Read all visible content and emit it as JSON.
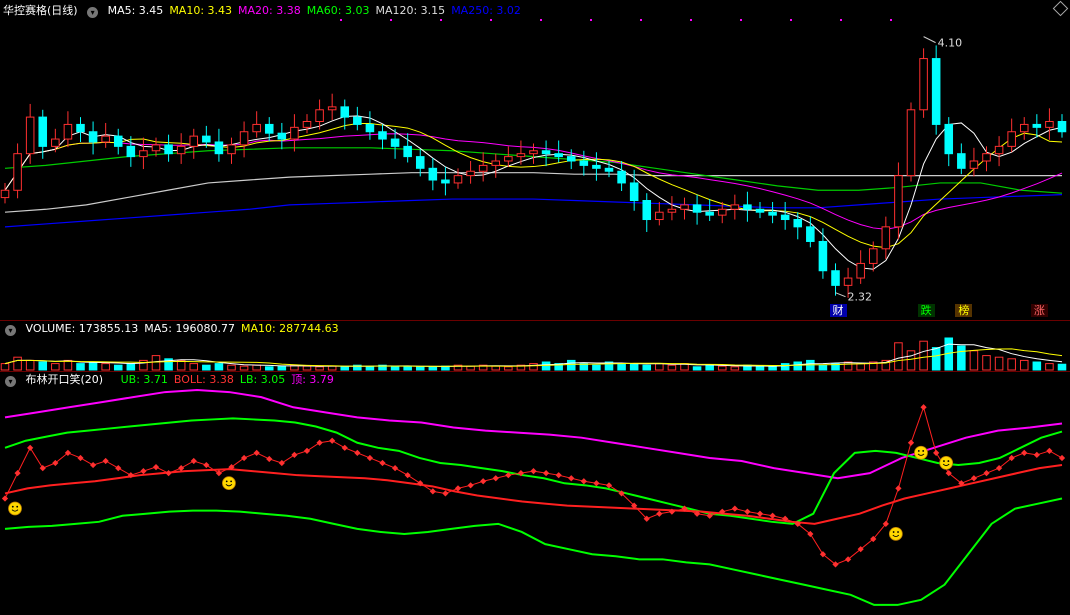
{
  "main": {
    "title": "华控赛格(日线)",
    "indicators": [
      {
        "label": "MA5: 3.45",
        "color": "#ffffff"
      },
      {
        "label": "MA10: 3.43",
        "color": "#ffff00"
      },
      {
        "label": "MA20: 3.38",
        "color": "#ff00ff"
      },
      {
        "label": "MA60: 3.03",
        "color": "#00ff00"
      },
      {
        "label": "MA120: 3.15",
        "color": "#dddddd"
      },
      {
        "label": "MA250: 3.02",
        "color": "#0000ff"
      }
    ],
    "high_label": "4.10",
    "low_label": "2.32",
    "events": [
      {
        "label": "财",
        "color": "#ffffff",
        "bg": "#0000aa"
      },
      {
        "label": "跌",
        "color": "#00ff00",
        "bg": "#003300"
      },
      {
        "label": "榜",
        "color": "#ffff00",
        "bg": "#553300"
      },
      {
        "label": "涨",
        "color": "#ff6666",
        "bg": "#330000"
      }
    ]
  },
  "volume": {
    "indicators": [
      {
        "label": "VOLUME: 173855.13",
        "color": "#ffffff"
      },
      {
        "label": "MA5: 196080.77",
        "color": "#ffffff"
      },
      {
        "label": "MA10: 287744.63",
        "color": "#ffff00"
      }
    ]
  },
  "boll": {
    "title": "布林开口笑(20)",
    "indicators": [
      {
        "label": "UB: 3.71",
        "color": "#00ff00"
      },
      {
        "label": "BOLL: 3.38",
        "color": "#ff3333"
      },
      {
        "label": "LB: 3.05",
        "color": "#00ff00"
      },
      {
        "label": "顶: 3.79",
        "color": "#ff00ff"
      }
    ]
  },
  "chart_data": {
    "type": "line",
    "price_ylim": [
      2.3,
      4.2
    ],
    "close": [
      3.05,
      3.3,
      3.55,
      3.35,
      3.4,
      3.5,
      3.45,
      3.38,
      3.42,
      3.35,
      3.28,
      3.32,
      3.36,
      3.3,
      3.35,
      3.42,
      3.38,
      3.3,
      3.36,
      3.45,
      3.5,
      3.44,
      3.4,
      3.48,
      3.52,
      3.6,
      3.62,
      3.55,
      3.5,
      3.45,
      3.4,
      3.35,
      3.28,
      3.2,
      3.12,
      3.1,
      3.15,
      3.18,
      3.22,
      3.25,
      3.28,
      3.3,
      3.32,
      3.3,
      3.28,
      3.25,
      3.22,
      3.2,
      3.18,
      3.1,
      2.98,
      2.85,
      2.9,
      2.92,
      2.95,
      2.9,
      2.88,
      2.92,
      2.95,
      2.92,
      2.9,
      2.88,
      2.85,
      2.8,
      2.7,
      2.5,
      2.4,
      2.45,
      2.55,
      2.65,
      2.8,
      3.15,
      3.6,
      3.95,
      3.5,
      3.3,
      3.2,
      3.25,
      3.3,
      3.35,
      3.45,
      3.5,
      3.48,
      3.52,
      3.45
    ],
    "ma_series": [
      {
        "name": "MA5",
        "color": "#ffffff"
      },
      {
        "name": "MA10",
        "color": "#ffff00"
      },
      {
        "name": "MA20",
        "color": "#ff00ff"
      },
      {
        "name": "MA60",
        "color": "#00ff00"
      },
      {
        "name": "MA120",
        "color": "#dddddd"
      },
      {
        "name": "MA250",
        "color": "#0000ff"
      }
    ],
    "ma60": [
      3.2,
      3.22,
      3.25,
      3.28,
      3.3,
      3.32,
      3.33,
      3.34,
      3.34,
      3.34,
      3.33,
      3.32,
      3.3,
      3.28,
      3.26,
      3.24,
      3.2,
      3.16,
      3.12,
      3.08,
      3.05,
      3.05,
      3.07,
      3.1,
      3.1,
      3.05,
      3.03
    ],
    "ma120": [
      2.9,
      2.92,
      2.95,
      3.0,
      3.05,
      3.1,
      3.12,
      3.14,
      3.15,
      3.16,
      3.17,
      3.17,
      3.17,
      3.17,
      3.16,
      3.16,
      3.15,
      3.15,
      3.15,
      3.15,
      3.15,
      3.15,
      3.15,
      3.15,
      3.15,
      3.15,
      3.15
    ],
    "ma250": [
      2.8,
      2.82,
      2.84,
      2.86,
      2.88,
      2.9,
      2.92,
      2.95,
      2.96,
      2.97,
      2.98,
      2.99,
      2.99,
      2.99,
      2.98,
      2.97,
      2.96,
      2.95,
      2.94,
      2.93,
      2.93,
      2.95,
      2.97,
      2.99,
      3.0,
      3.01,
      3.02
    ],
    "boll_ub": [
      3.55,
      3.62,
      3.66,
      3.7,
      3.72,
      3.74,
      3.76,
      3.78,
      3.8,
      3.82,
      3.83,
      3.84,
      3.83,
      3.82,
      3.8,
      3.76,
      3.7,
      3.6,
      3.55,
      3.52,
      3.45,
      3.4,
      3.38,
      3.35,
      3.32,
      3.28,
      3.25,
      3.2,
      3.18,
      3.15,
      3.1,
      3.05,
      3.0,
      2.95,
      2.9,
      2.88,
      2.85,
      2.82,
      2.8,
      2.9,
      3.3,
      3.5,
      3.52,
      3.5,
      3.45,
      3.4,
      3.38,
      3.4,
      3.45,
      3.55,
      3.65,
      3.71
    ],
    "boll_mid": [
      3.1,
      3.15,
      3.18,
      3.2,
      3.22,
      3.25,
      3.28,
      3.3,
      3.32,
      3.33,
      3.34,
      3.32,
      3.3,
      3.28,
      3.27,
      3.26,
      3.25,
      3.23,
      3.2,
      3.17,
      3.12,
      3.08,
      3.05,
      3.02,
      3.0,
      2.98,
      2.97,
      2.96,
      2.95,
      2.94,
      2.93,
      2.92,
      2.9,
      2.88,
      2.85,
      2.82,
      2.8,
      2.85,
      2.9,
      2.98,
      3.05,
      3.1,
      3.15,
      3.2,
      3.25,
      3.3,
      3.35,
      3.38
    ],
    "boll_lb": [
      2.75,
      2.77,
      2.78,
      2.8,
      2.82,
      2.88,
      2.9,
      2.92,
      2.93,
      2.93,
      2.92,
      2.9,
      2.88,
      2.85,
      2.8,
      2.75,
      2.72,
      2.7,
      2.72,
      2.75,
      2.78,
      2.8,
      2.72,
      2.6,
      2.55,
      2.5,
      2.48,
      2.45,
      2.45,
      2.42,
      2.4,
      2.35,
      2.3,
      2.25,
      2.2,
      2.15,
      2.1,
      2.0,
      2.0,
      2.05,
      2.2,
      2.5,
      2.8,
      2.95,
      3.0,
      3.05
    ],
    "boll_top": [
      3.85,
      3.9,
      3.95,
      4.0,
      4.05,
      4.1,
      4.12,
      4.1,
      4.05,
      3.95,
      3.9,
      3.85,
      3.82,
      3.8,
      3.75,
      3.72,
      3.7,
      3.68,
      3.65,
      3.6,
      3.55,
      3.5,
      3.45,
      3.42,
      3.35,
      3.3,
      3.25,
      3.3,
      3.45,
      3.55,
      3.65,
      3.72,
      3.75,
      3.79
    ],
    "volume": [
      0.2,
      0.4,
      0.3,
      0.25,
      0.2,
      0.3,
      0.2,
      0.25,
      0.2,
      0.15,
      0.2,
      0.3,
      0.45,
      0.35,
      0.3,
      0.2,
      0.15,
      0.2,
      0.15,
      0.12,
      0.15,
      0.1,
      0.12,
      0.15,
      0.12,
      0.1,
      0.12,
      0.1,
      0.15,
      0.12,
      0.15,
      0.1,
      0.12,
      0.1,
      0.1,
      0.12,
      0.15,
      0.12,
      0.15,
      0.12,
      0.1,
      0.15,
      0.2,
      0.25,
      0.2,
      0.3,
      0.2,
      0.15,
      0.25,
      0.2,
      0.2,
      0.15,
      0.2,
      0.15,
      0.2,
      0.1,
      0.15,
      0.12,
      0.1,
      0.15,
      0.12,
      0.1,
      0.2,
      0.25,
      0.3,
      0.15,
      0.2,
      0.25,
      0.2,
      0.25,
      0.3,
      0.85,
      0.6,
      0.9,
      0.7,
      1.0,
      0.75,
      0.6,
      0.45,
      0.4,
      0.35,
      0.3,
      0.25,
      0.2,
      0.18
    ]
  }
}
